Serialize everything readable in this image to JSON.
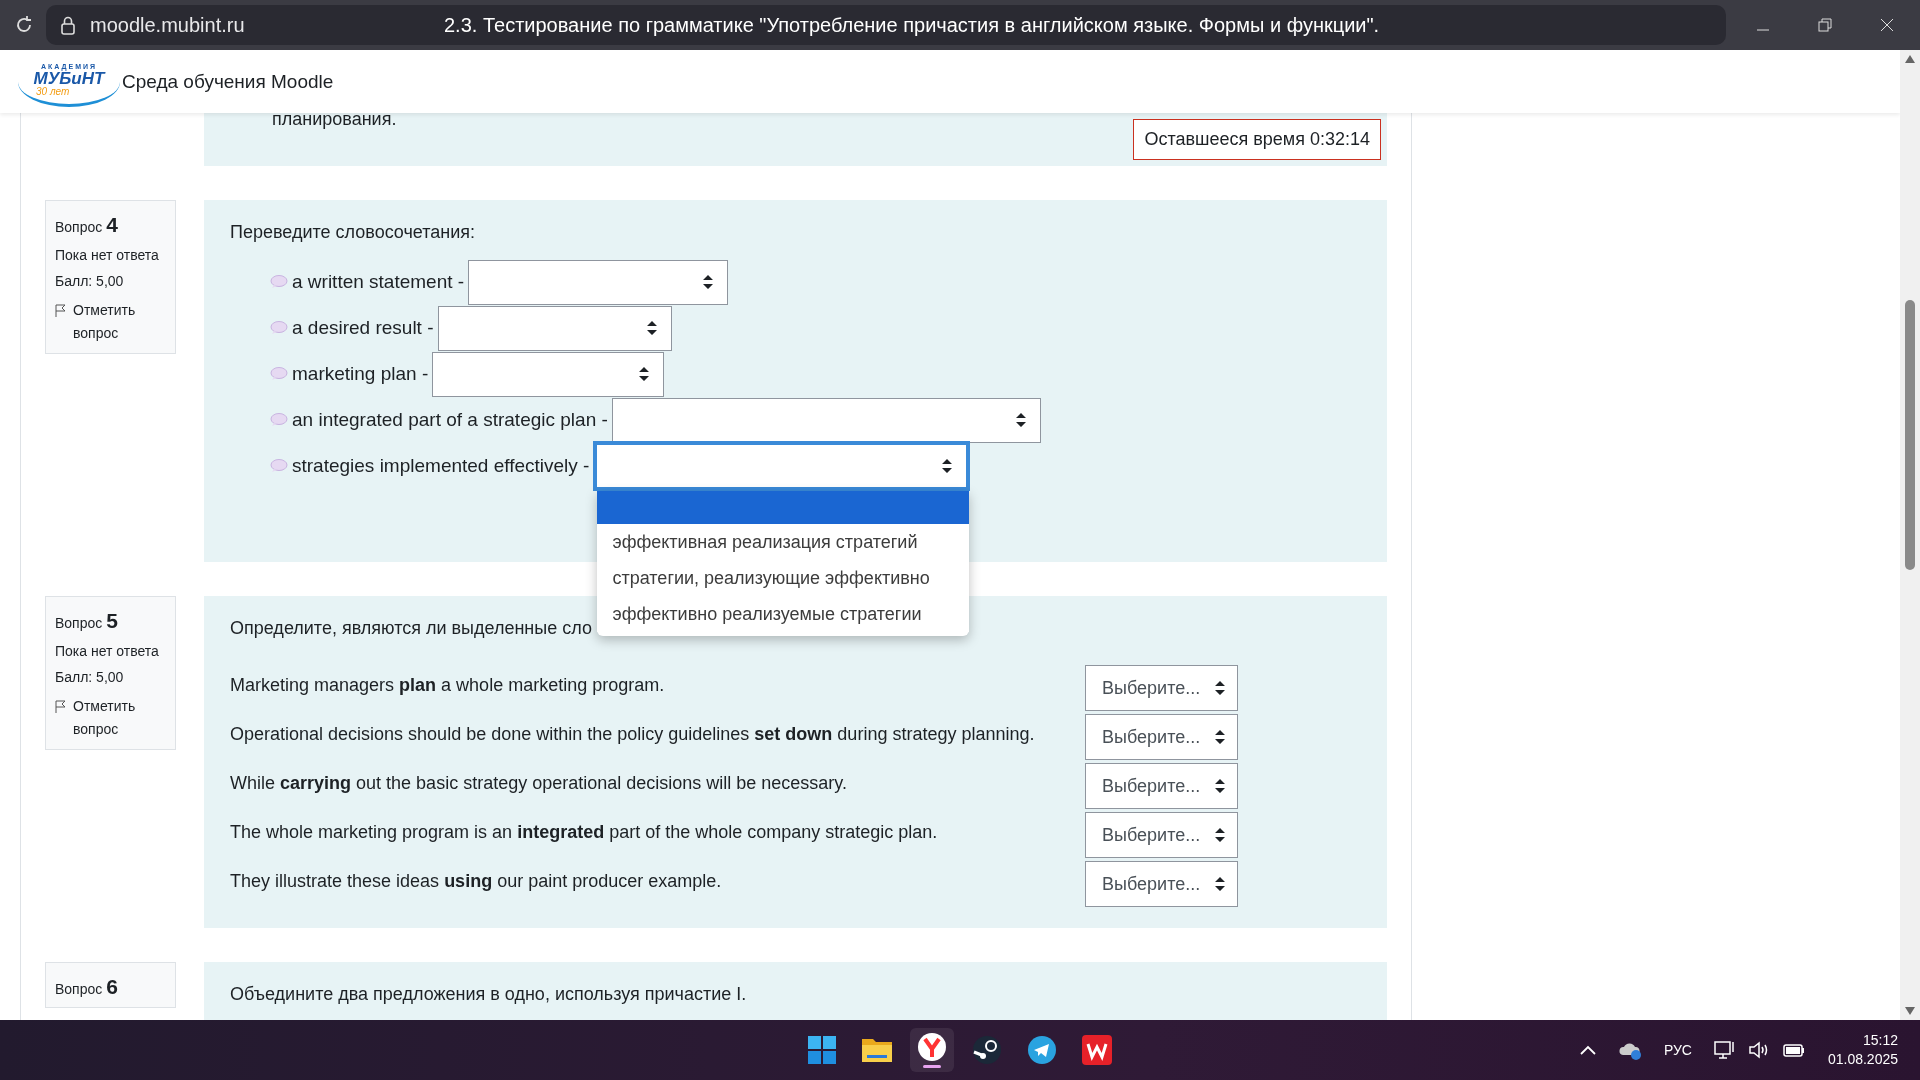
{
  "browser": {
    "url": "moodle.mubint.ru",
    "title": "2.3. Тестирование по грамматике \"Употребление причастия в английском языке. Формы и функции\"."
  },
  "header": {
    "logo": {
      "top": "АКАДЕМИЯ",
      "name": "МУБиНТ",
      "tagline": "30 лет"
    },
    "site_name": "Среда обучения Moodle"
  },
  "previous_question": {
    "text_tail": "планирования.",
    "timer": "Оставшееся время 0:32:14"
  },
  "questions": [
    {
      "kind": "match",
      "label": "Вопрос",
      "number": "4",
      "status": "Пока нет ответа",
      "grade": "Балл: 5,00",
      "flag": "Отметить вопрос",
      "prompt": "Переведите словосочетания:",
      "items": [
        {
          "text": "a written statement -",
          "focused": false
        },
        {
          "text": "a desired result -",
          "focused": false
        },
        {
          "text": "marketing plan -",
          "focused": false
        },
        {
          "text": "an integrated part of a strategic plan -",
          "focused": false
        },
        {
          "text": "strategies implemented effectively -",
          "focused": true,
          "options": [
            {
              "selected": true
            },
            {
              "text": "эффективная реализация стратегий",
              "selected": false
            },
            {
              "text": "стратегии, реализующие эффективно",
              "selected": false
            },
            {
              "text": "эффективно реализуемые стратегии",
              "selected": false
            }
          ]
        }
      ]
    },
    {
      "kind": "choice",
      "label": "Вопрос",
      "number": "5",
      "status": "Пока нет ответа",
      "grade": "Балл: 5,00",
      "flag": "Отметить вопрос",
      "prompt": "Определите, являются ли выделенные сло",
      "items": [
        {
          "text": "Marketing managers **plan** a whole marketing program.",
          "value": "Выберите..."
        },
        {
          "text": "Operational decisions should be done within the policy guidelines **set down** during strategy planning.",
          "value": "Выберите..."
        },
        {
          "text": "While **carrying** out the basic strategy operational decisions will be necessary.",
          "value": "Выберите..."
        },
        {
          "text": "The whole marketing program is an **integrated** part of the whole company strategic plan.",
          "value": "Выберите..."
        },
        {
          "text": "They illustrate these ideas **using** our paint producer example.",
          "value": "Выберите..."
        }
      ]
    },
    {
      "kind": "text",
      "label": "Вопрос",
      "number": "6",
      "prompt": "Объедините два предложения в одно, используя причастие I."
    }
  ],
  "taskbar": {
    "language": "РУС",
    "time": "15:12",
    "date": "01.08.2025"
  }
}
